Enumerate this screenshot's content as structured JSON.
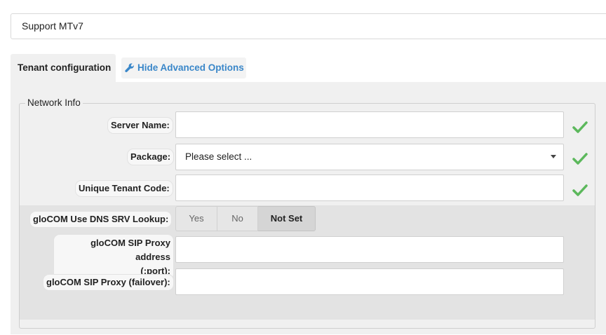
{
  "breadcrumb": {
    "title": "Support MTv7"
  },
  "tabs": {
    "active_label": "Tenant configuration",
    "advanced_label": "Hide Advanced Options",
    "advanced_icon": "wrench-icon"
  },
  "fieldset": {
    "legend": "Network Info",
    "fields": {
      "server_name": {
        "label": "Server Name:",
        "value": ""
      },
      "package": {
        "label": "Package:",
        "selected": "Please select ..."
      },
      "tenant_code": {
        "label": "Unique Tenant Code:",
        "value": ""
      },
      "dns_srv": {
        "label": "gloCOM Use DNS SRV Lookup:",
        "options": {
          "yes": "Yes",
          "no": "No",
          "not_set": "Not Set"
        },
        "selected": "Not Set"
      },
      "sip_proxy": {
        "label_line1": "gloCOM SIP Proxy address",
        "label_line2": "(:port):",
        "value": ""
      },
      "sip_failover": {
        "label": "gloCOM SIP Proxy (failover):",
        "value": ""
      }
    }
  },
  "colors": {
    "accent": "#3a87c9",
    "valid_check": "#5cb85c"
  },
  "icons": {
    "valid": "checkmark-icon",
    "dropdown": "caret-down-icon"
  }
}
